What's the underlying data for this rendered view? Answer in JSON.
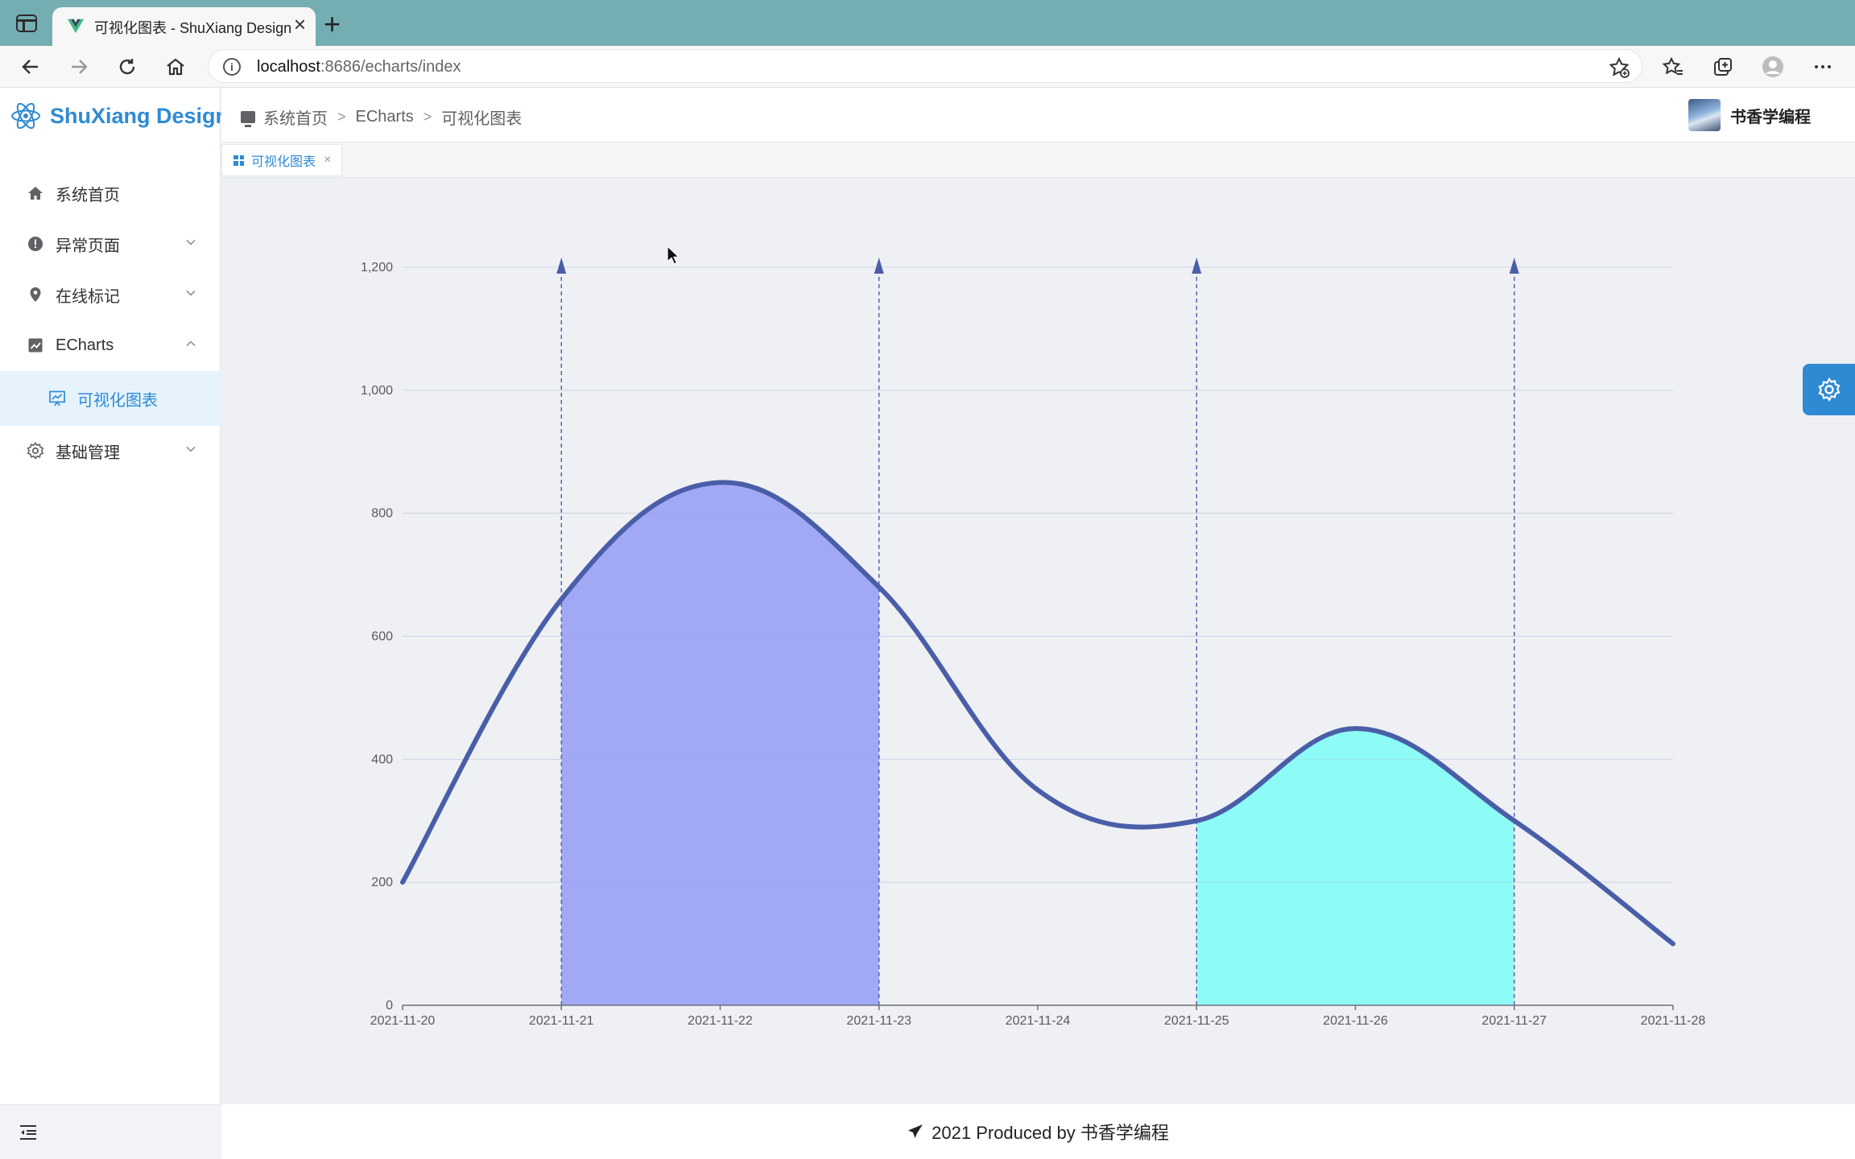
{
  "browser": {
    "tab_title": "可视化图表 - ShuXiang Design",
    "tab_close": "×",
    "new_tab": "+",
    "url_host": "localhost",
    "url_path": ":8686/echarts/index"
  },
  "sidebar": {
    "logo": "ShuXiang Design",
    "items": [
      {
        "label": "系统首页",
        "icon": "home-icon"
      },
      {
        "label": "异常页面",
        "icon": "warning-icon",
        "expandable": true
      },
      {
        "label": "在线标记",
        "icon": "location-icon",
        "expandable": true
      },
      {
        "label": "ECharts",
        "icon": "chart-icon",
        "expanded": true
      },
      {
        "label": "可视化图表",
        "icon": "monitor-chart-icon",
        "active": true
      },
      {
        "label": "基础管理",
        "icon": "gear-icon",
        "expandable": true
      }
    ]
  },
  "header": {
    "breadcrumb": [
      "系统首页",
      "ECharts",
      "可视化图表"
    ],
    "separator": ">",
    "user_name": "书香学编程"
  },
  "tags": [
    {
      "label": "可视化图表",
      "close": "×"
    }
  ],
  "chart_data": {
    "type": "line",
    "smooth": true,
    "x": [
      "2021-11-20",
      "2021-11-21",
      "2021-11-22",
      "2021-11-23",
      "2021-11-24",
      "2021-11-25",
      "2021-11-26",
      "2021-11-27",
      "2021-11-28"
    ],
    "values": [
      200,
      660,
      850,
      680,
      350,
      300,
      450,
      300,
      100
    ],
    "ylim": [
      0,
      1200
    ],
    "yticks": [
      0,
      200,
      400,
      600,
      800,
      1000,
      1200
    ],
    "ytick_labels": [
      "0",
      "200",
      "400",
      "600",
      "800",
      "1,000",
      "1,200"
    ],
    "line_color": "#4a5ea8",
    "mark_areas": [
      {
        "from": "2021-11-21",
        "to": "2021-11-23",
        "color": "#a1a8f5"
      },
      {
        "from": "2021-11-25",
        "to": "2021-11-27",
        "color": "#8dfcf6"
      }
    ],
    "mark_lines_x": [
      "2021-11-21",
      "2021-11-23",
      "2021-11-25",
      "2021-11-27"
    ],
    "grid": "horizontal"
  },
  "footer": {
    "text": "2021 Produced by 书香学编程"
  }
}
